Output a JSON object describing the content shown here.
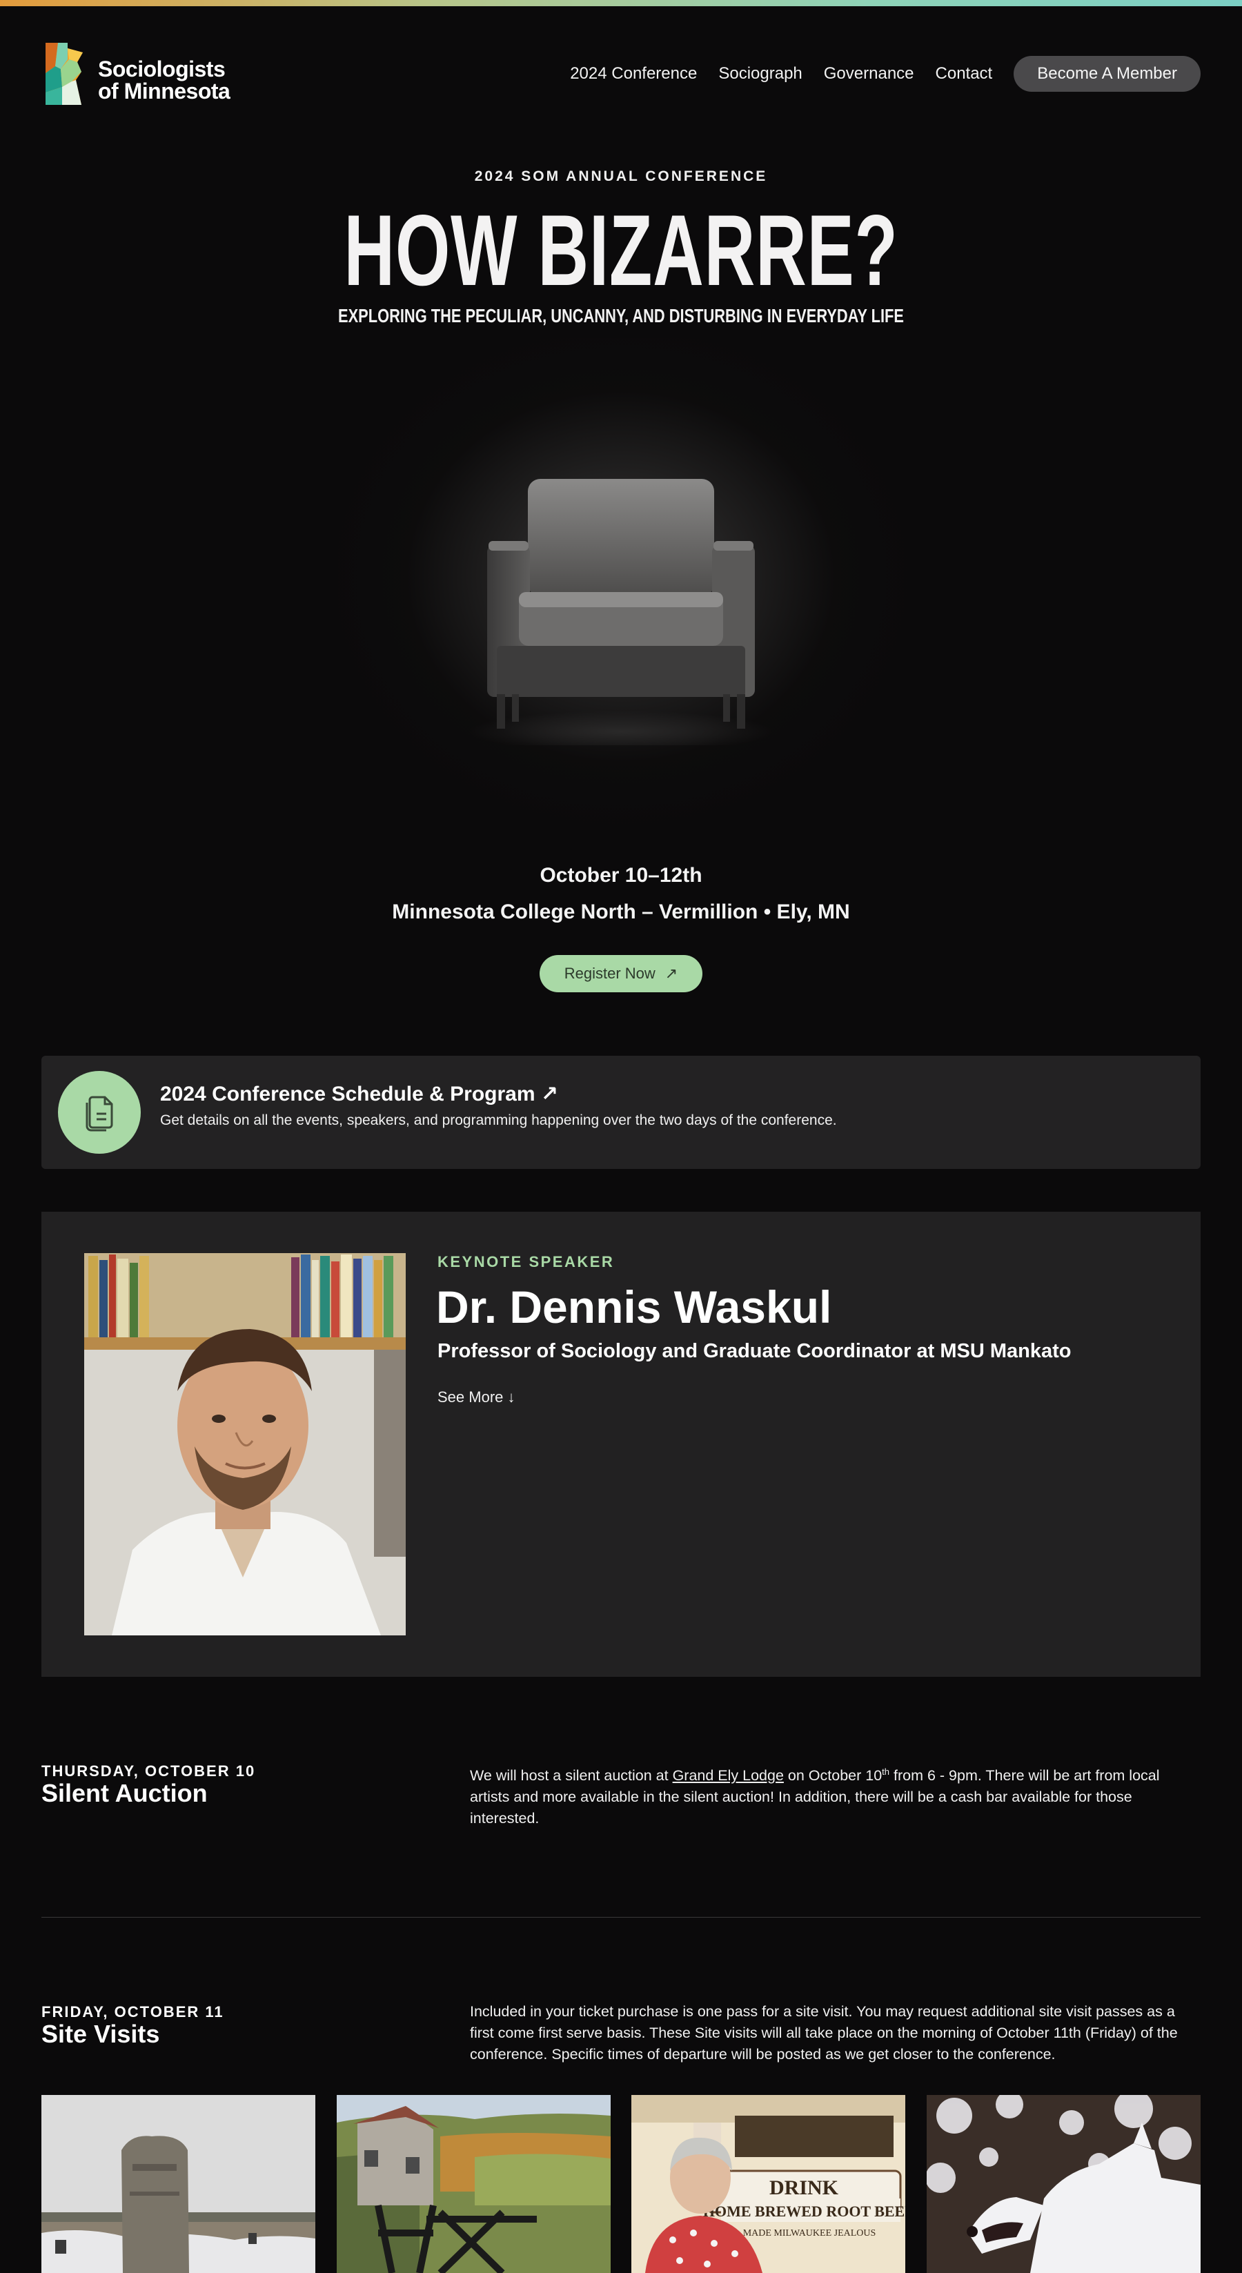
{
  "nav": {
    "logo_line1": "Sociologists",
    "logo_line2": "of Minnesota",
    "links": [
      "2024 Conference",
      "Sociograph",
      "Governance",
      "Contact"
    ],
    "cta": "Become A Member"
  },
  "hero": {
    "eyebrow": "2024 SOM ANNUAL CONFERENCE",
    "title": "HOW BIZARRE?",
    "subtitle": "EXPLORING THE PECULIAR, UNCANNY, AND DISTURBING IN EVERYDAY LIFE",
    "dates": "October 10–12th",
    "venue": "Minnesota College North – Vermillion • Ely, MN",
    "register": "Register Now",
    "register_arrow": "↗"
  },
  "schedule": {
    "title": "2024 Conference Schedule & Program ↗",
    "description": "Get details on all the events, speakers, and programming happening over the two days of the conference."
  },
  "keynote": {
    "eyebrow": "KEYNOTE SPEAKER",
    "name": "Dr. Dennis Waskul",
    "role": "Professor of Sociology and Graduate Coordinator at MSU Mankato",
    "see_more": "See More ↓"
  },
  "events": [
    {
      "date": "THURSDAY, OCTOBER 10",
      "title": "Silent Auction",
      "text_before": "We will host a silent auction at ",
      "link": "Grand Ely Lodge",
      "text_mid": " on October 10",
      "sup": "th",
      "text_after": " from 6 - 9pm. There will be art from local artists and more available in the silent auction! In addition, there will be a cash bar available for those interested."
    },
    {
      "date": "FRIDAY, OCTOBER 11",
      "title": "Site Visits",
      "text": "Included in your ticket purchase is one pass for a site visit. You may request additional site visit passes as a first come first serve basis. These Site visits will all take place on the morning of October 11th (Friday) of the conference. Specific times of departure will be posted as we get closer to the conference."
    }
  ],
  "site_photos": [
    {
      "name": "cemetery-photo"
    },
    {
      "name": "mine-headframe-photo"
    },
    {
      "name": "root-beer-lady-photo",
      "sign_line1": "DRINK",
      "sign_line2": "HOME BREWED ROOT BEER",
      "sign_line3": "MADE MILWAUKEE JEALOUS"
    },
    {
      "name": "wolf-photo"
    }
  ],
  "colors": {
    "background": "#0b0a0b",
    "card": "#232223",
    "accent_green": "#a9d9a6",
    "button_gray": "#4a494b"
  }
}
